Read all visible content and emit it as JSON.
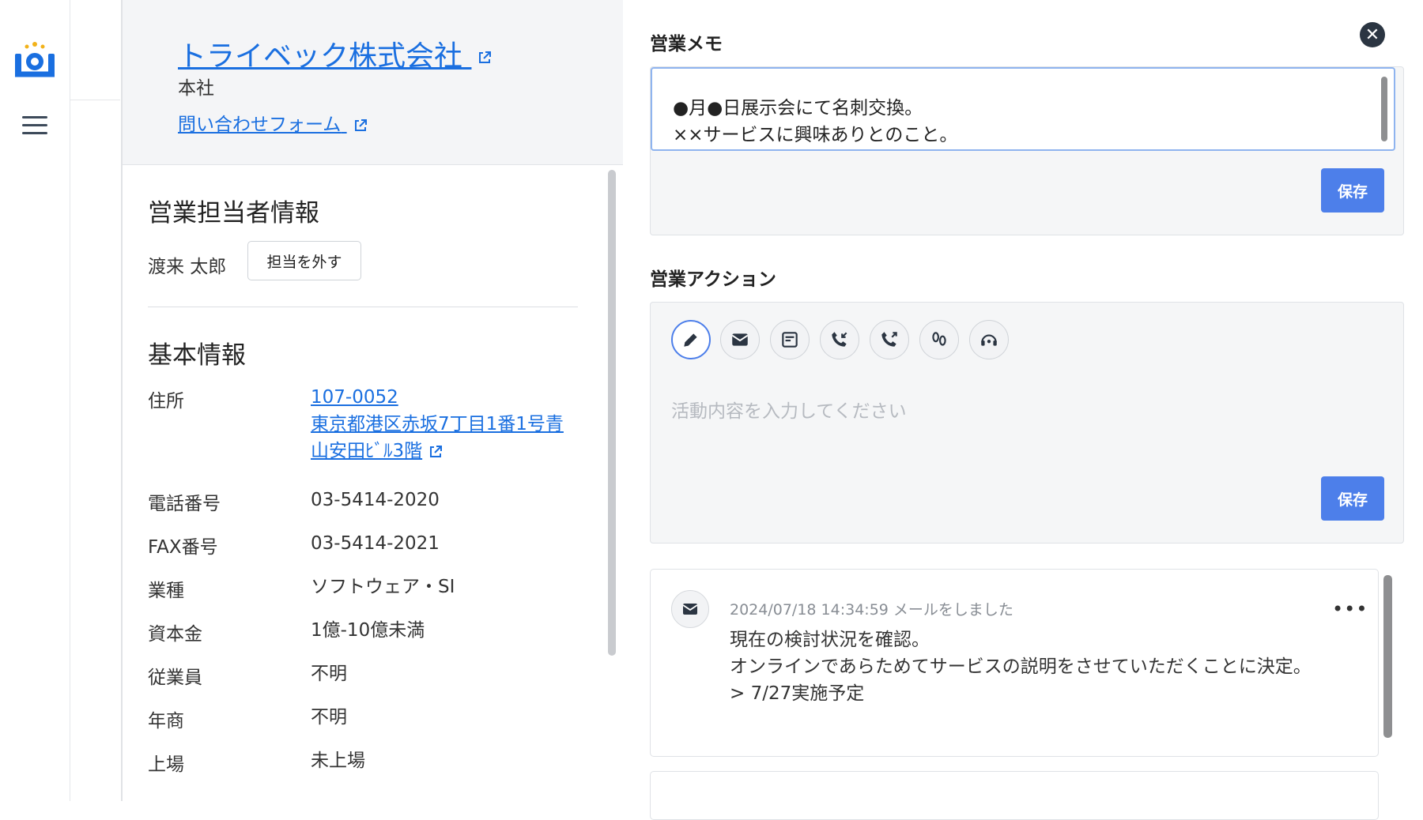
{
  "company": {
    "name": "トライベック株式会社",
    "branch": "本社",
    "contact_form_label": "問い合わせフォーム"
  },
  "sales_rep": {
    "section_title": "営業担当者情報",
    "name": "渡来 太郎",
    "unassign_label": "担当を外す"
  },
  "basic_info": {
    "section_title": "基本情報",
    "address_label": "住所",
    "postal_code": "107-0052",
    "address_line1": "東京都港区赤坂7丁目1番1号青",
    "address_line2": "山安田ﾋﾞﾙ3階",
    "rows": [
      {
        "label": "電話番号",
        "value": "03-5414-2020"
      },
      {
        "label": "FAX番号",
        "value": "03-5414-2021"
      },
      {
        "label": "業種",
        "value": "ソフトウェア・SI"
      },
      {
        "label": "資本金",
        "value": "1億-10億未満"
      },
      {
        "label": "従業員",
        "value": "不明"
      },
      {
        "label": "年商",
        "value": "不明"
      },
      {
        "label": "上場",
        "value": "未上場"
      }
    ]
  },
  "memo": {
    "title": "営業メモ",
    "line1": "●月●日展示会にて名刺交換。",
    "line2": "××サービスに興味ありとのこと。",
    "save_label": "保存"
  },
  "actions": {
    "title": "営業アクション",
    "icons": [
      "pencil-icon",
      "mail-icon",
      "form-icon",
      "phone-incoming-icon",
      "phone-outgoing-icon",
      "visit-icon",
      "support-icon"
    ],
    "placeholder": "活動内容を入力してください",
    "save_label": "保存"
  },
  "feed": {
    "items": [
      {
        "meta": "2024/07/18 14:34:59  メールをしました",
        "line1": "現在の検討状況を確認。",
        "line2": "オンラインであらためてサービスの説明をさせていただくことに決定。",
        "line3": "> 7/27実施予定"
      }
    ]
  },
  "colors": {
    "accent": "#4d7fea",
    "link": "#1a6fe0",
    "panel_bg": "#f5f6f7"
  }
}
